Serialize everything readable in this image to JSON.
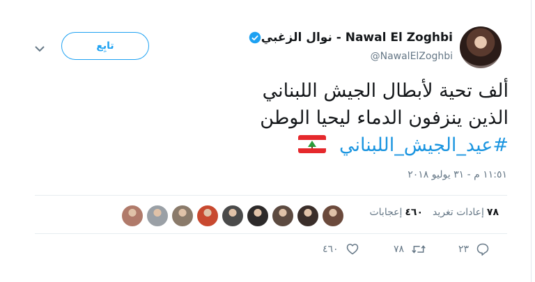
{
  "header": {
    "display_name": "نوال الزغبي - Nawal El Zoghbi",
    "handle": "@NawalElZoghbi",
    "follow_label": "تابِع"
  },
  "tweet": {
    "line1": "ألف تحية لأبطال الجيش اللبناني",
    "line2": "الذين ينزفون الدماء ليحيا الوطن",
    "hashtag": "#عيد_الجيش_اللبناني",
    "timestamp": "١١:٥١ م - ٣١ يوليو ٢٠١٨"
  },
  "stats": {
    "retweets_count": "٧٨",
    "retweets_label": "إعادات تغريد",
    "likes_count": "٤٦٠",
    "likes_label": "إعجابات"
  },
  "actions": {
    "reply_count": "٢٣",
    "retweet_count": "٧٨",
    "like_count": "٤٦٠"
  },
  "likers": [
    {
      "color": "#6b4a3c"
    },
    {
      "color": "#3a2e2a"
    },
    {
      "color": "#5c4a40"
    },
    {
      "color": "#2d2a2a"
    },
    {
      "color": "#4a4a4a"
    },
    {
      "color": "#c8492f"
    },
    {
      "color": "#8a7a6a"
    },
    {
      "color": "#9aa0a6"
    },
    {
      "color": "#b07a6a"
    }
  ],
  "colors": {
    "accent": "#1da1f2",
    "hashtag": "#1b95e0",
    "muted": "#657786"
  }
}
